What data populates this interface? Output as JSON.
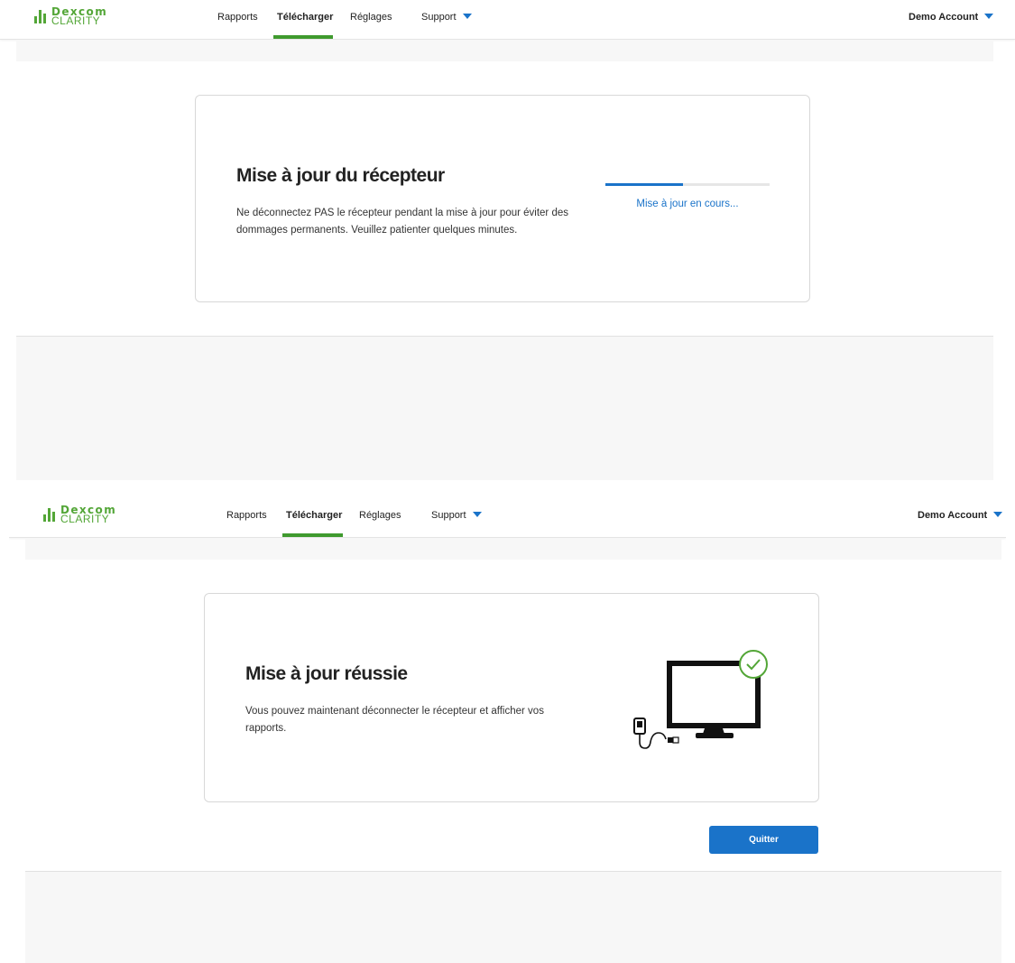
{
  "brand": {
    "line1": "Dexcom",
    "line2": "CLARITY",
    "color": "#53a637"
  },
  "nav": {
    "items": [
      {
        "label": "Rapports",
        "active": false
      },
      {
        "label": "Télécharger",
        "active": true
      },
      {
        "label": "Réglages",
        "active": false
      },
      {
        "label": "Support",
        "active": false,
        "has_dropdown": true
      }
    ],
    "account_label": "Demo Account"
  },
  "screen_updating": {
    "title": "Mise à jour du récepteur",
    "body": "Ne déconnectez PAS le récepteur pendant la mise à jour pour éviter des dommages permanents. Veuillez patienter quelques minutes.",
    "progress_fraction": 0.47,
    "progress_label": "Mise à jour en cours..."
  },
  "screen_success": {
    "title": "Mise à jour réussie",
    "body": "Vous pouvez maintenant déconnecter le récepteur et afficher vos rapports.",
    "illustration": "receiver-connected-to-monitor-with-check-icon",
    "quit_label": "Quitter"
  },
  "colors": {
    "accent": "#1a73c9",
    "active_tab": "#3f9a2e",
    "success": "#53a637"
  }
}
